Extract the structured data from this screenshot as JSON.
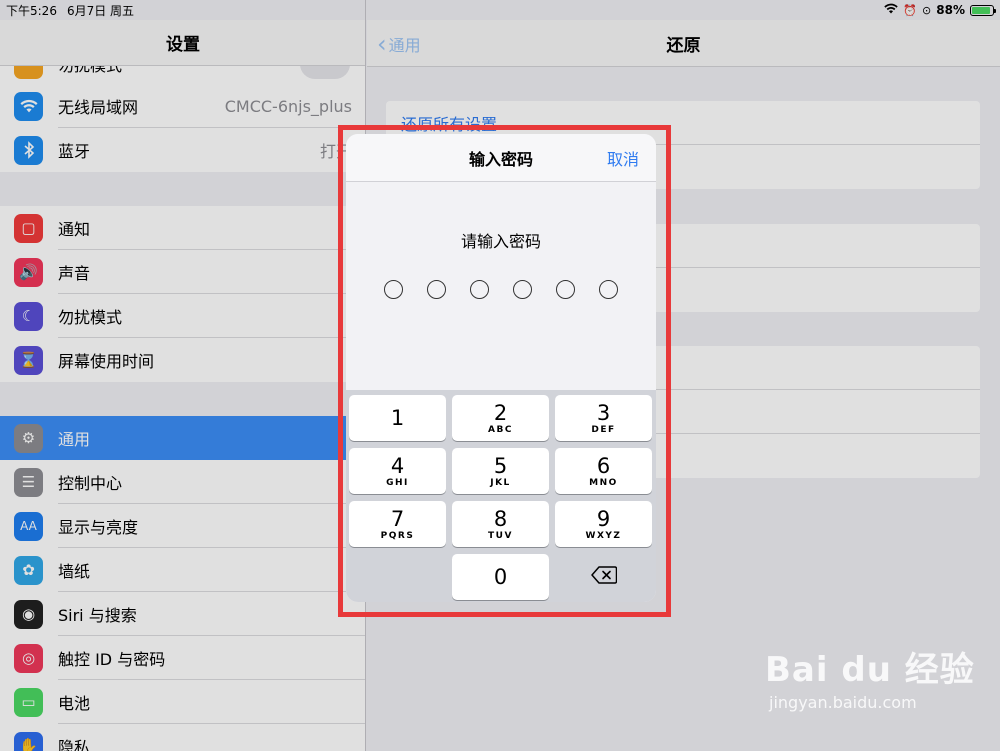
{
  "status": {
    "time": "下午5:26",
    "date": "6月7日 周五",
    "battery": "88%",
    "battery_level": 0.88
  },
  "left": {
    "title": "设置",
    "top_partial_label": "勿扰模式",
    "wifi": {
      "label": "无线局域网",
      "value": "CMCC-6njs_plus",
      "icon": "wifi-icon",
      "color": "#1e8cf0"
    },
    "bluetooth": {
      "label": "蓝牙",
      "value": "打开",
      "icon": "bluetooth-icon",
      "color": "#1e8cf0"
    },
    "group2": [
      {
        "label": "通知",
        "icon": "notification-icon",
        "color": "#f23b3b"
      },
      {
        "label": "声音",
        "icon": "speaker-icon",
        "color": "#f2365b"
      },
      {
        "label": "勿扰模式",
        "icon": "moon-icon",
        "color": "#5a4fd6"
      },
      {
        "label": "屏幕使用时间",
        "icon": "hourglass-icon",
        "color": "#5a4fd6"
      }
    ],
    "group3": [
      {
        "label": "通用",
        "icon": "gear-icon",
        "color": "#8e8e93",
        "selected": true
      },
      {
        "label": "控制中心",
        "icon": "switches-icon",
        "color": "#8e8e93"
      },
      {
        "label": "显示与亮度",
        "icon": "text-size-icon",
        "color": "#1e7ef0"
      },
      {
        "label": "墙纸",
        "icon": "flower-icon",
        "color": "#30a8e8"
      },
      {
        "label": "Siri 与搜索",
        "icon": "siri-icon",
        "color": "#222222"
      },
      {
        "label": "触控 ID 与密码",
        "icon": "fingerprint-icon",
        "color": "#f0385a"
      },
      {
        "label": "电池",
        "icon": "battery-icon",
        "color": "#4cd964"
      },
      {
        "label": "隐私",
        "icon": "hand-icon",
        "color": "#2e6ef0"
      }
    ]
  },
  "right": {
    "title": "还原",
    "back_label": "通用",
    "first_cell": "还原所有设置"
  },
  "modal": {
    "title": "输入密码",
    "cancel": "取消",
    "prompt": "请输入密码",
    "digits_entered": 0,
    "keys": [
      {
        "num": "1",
        "letters": ""
      },
      {
        "num": "2",
        "letters": "ABC"
      },
      {
        "num": "3",
        "letters": "DEF"
      },
      {
        "num": "4",
        "letters": "GHI"
      },
      {
        "num": "5",
        "letters": "JKL"
      },
      {
        "num": "6",
        "letters": "MNO"
      },
      {
        "num": "7",
        "letters": "PQRS"
      },
      {
        "num": "8",
        "letters": "TUV"
      },
      {
        "num": "9",
        "letters": "WXYZ"
      },
      {
        "num": "0",
        "letters": ""
      }
    ],
    "delete_icon": "delete-key-icon"
  },
  "watermark": {
    "main": "Bai du 经验",
    "sub": "jingyan.baidu.com"
  },
  "colors": {
    "highlight_box": "#e8393a",
    "accent": "#2f7bf0",
    "selected_row": "#3c8ef6"
  }
}
